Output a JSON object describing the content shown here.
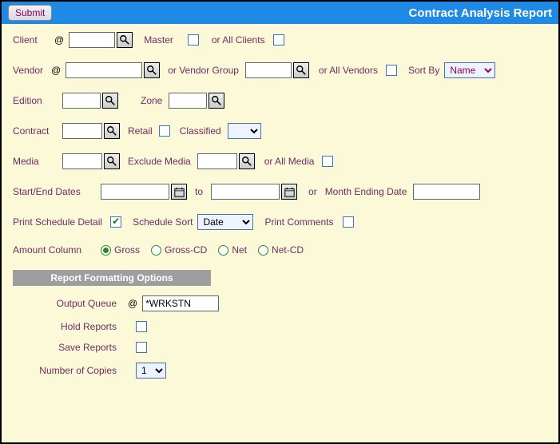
{
  "header": {
    "submit": "Submit",
    "title": "Contract Analysis Report"
  },
  "client": {
    "label": "Client",
    "at": "@",
    "value": "",
    "master": "Master",
    "or_all": "or All Clients"
  },
  "vendor": {
    "label": "Vendor",
    "at": "@",
    "value": "",
    "or_group": "or Vendor Group",
    "group_value": "",
    "or_all": "or All Vendors",
    "sort_by": "Sort By",
    "sort_value": "Name"
  },
  "edition": {
    "label": "Edition",
    "value": "",
    "zone_label": "Zone",
    "zone_value": ""
  },
  "contract": {
    "label": "Contract",
    "value": "",
    "retail": "Retail",
    "classified": "Classified",
    "classified_value": ""
  },
  "media": {
    "label": "Media",
    "value": "",
    "exclude": "Exclude Media",
    "exclude_value": "",
    "or_all": "or All Media"
  },
  "dates": {
    "label": "Start/End Dates",
    "start": "",
    "to": "to",
    "end": "",
    "or": "or",
    "month_ending": "Month Ending Date",
    "month_value": ""
  },
  "schedule": {
    "print_detail": "Print Schedule Detail",
    "sort_label": "Schedule Sort",
    "sort_value": "Date",
    "print_comments": "Print Comments"
  },
  "amount": {
    "label": "Amount Column",
    "gross": "Gross",
    "gross_cd": "Gross-CD",
    "net": "Net",
    "net_cd": "Net-CD"
  },
  "formatting": {
    "head": "Report Formatting Options",
    "output_queue": "Output Queue",
    "at": "@",
    "queue_value": "*WRKSTN",
    "hold": "Hold Reports",
    "save": "Save Reports",
    "copies_label": "Number of Copies",
    "copies_value": "1"
  }
}
